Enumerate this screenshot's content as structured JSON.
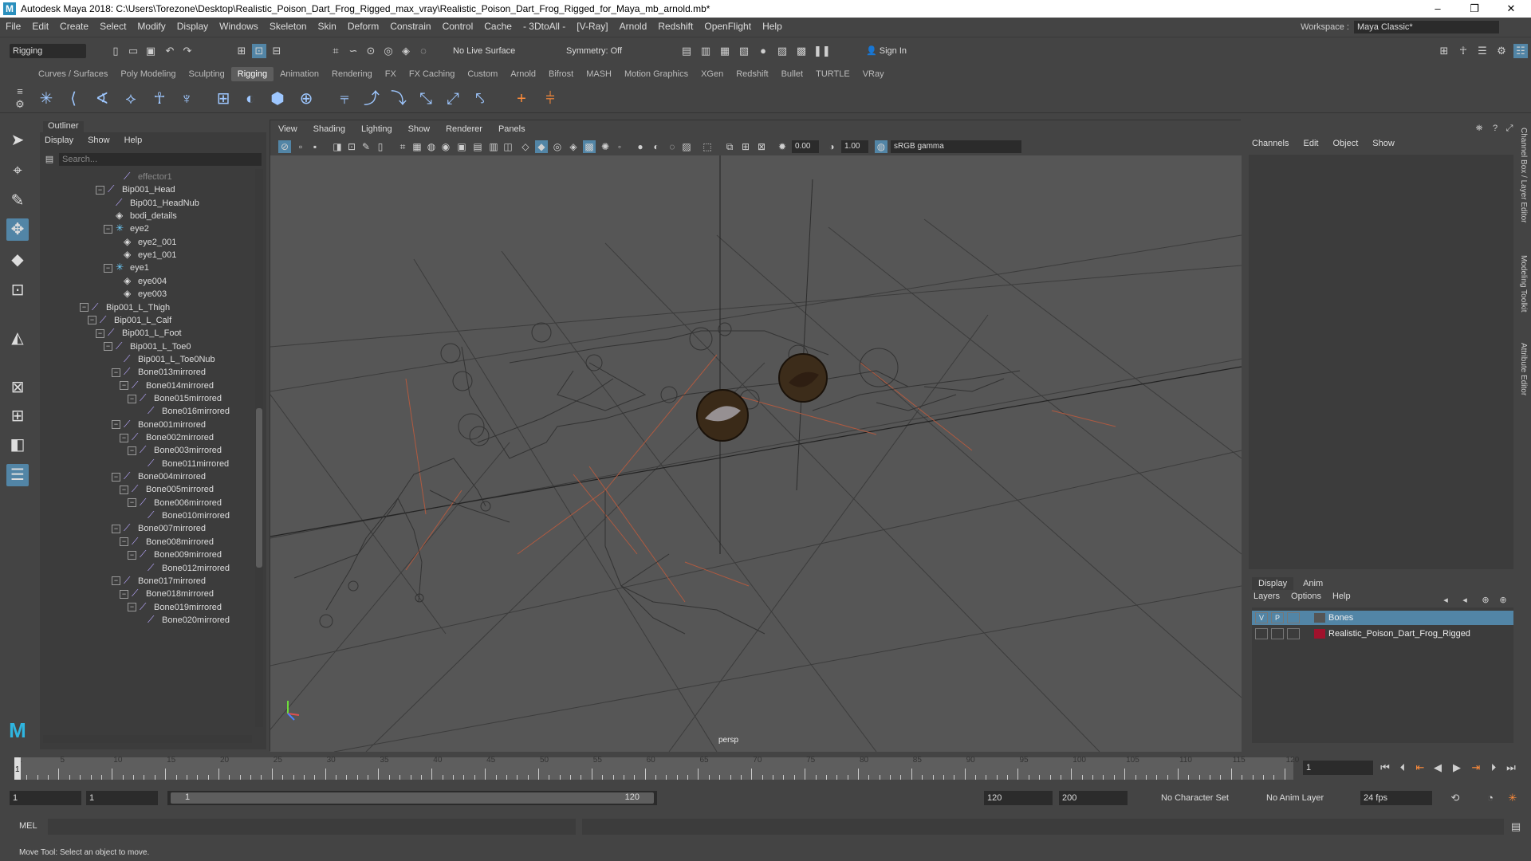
{
  "title": "Autodesk Maya 2018: C:\\Users\\Torezone\\Desktop\\Realistic_Poison_Dart_Frog_Rigged_max_vray\\Realistic_Poison_Dart_Frog_Rigged_for_Maya_mb_arnold.mb*",
  "window_controls": {
    "minimize": "–",
    "restore": "❐",
    "close": "✕"
  },
  "menu": [
    "File",
    "Edit",
    "Create",
    "Select",
    "Modify",
    "Display",
    "Windows",
    "Skeleton",
    "Skin",
    "Deform",
    "Constrain",
    "Control",
    "Cache",
    "- 3DtoAll -",
    "[V-Ray]",
    "Arnold",
    "Redshift",
    "OpenFlight",
    "Help"
  ],
  "workspace": {
    "label": "Workspace :",
    "value": "Maya Classic*"
  },
  "status": {
    "menu_set": "Rigging",
    "live_surface": "No Live Surface",
    "symmetry": "Symmetry: Off",
    "sign_in": "Sign In"
  },
  "shelf_tabs": [
    "Curves / Surfaces",
    "Poly Modeling",
    "Sculpting",
    "Rigging",
    "Animation",
    "Rendering",
    "FX",
    "FX Caching",
    "Custom",
    "Arnold",
    "Bifrost",
    "MASH",
    "Motion Graphics",
    "XGen",
    "Redshift",
    "Bullet",
    "TURTLE",
    "VRay"
  ],
  "shelf_active": "Rigging",
  "outliner": {
    "title": "Outliner",
    "menu": [
      "Display",
      "Show",
      "Help"
    ],
    "search_placeholder": "Search...",
    "nodes": [
      {
        "label": "effector1",
        "depth": 5,
        "type": "joint",
        "exp": ""
      },
      {
        "label": "Bip001_Head",
        "depth": 3,
        "type": "joint",
        "exp": "−"
      },
      {
        "label": "Bip001_HeadNub",
        "depth": 4,
        "type": "joint",
        "exp": ""
      },
      {
        "label": "bodi_details",
        "depth": 4,
        "type": "mesh",
        "exp": ""
      },
      {
        "label": "eye2",
        "depth": 4,
        "type": "grp",
        "exp": "−"
      },
      {
        "label": "eye2_001",
        "depth": 5,
        "type": "mesh",
        "exp": ""
      },
      {
        "label": "eye1_001",
        "depth": 5,
        "type": "mesh",
        "exp": ""
      },
      {
        "label": "eye1",
        "depth": 4,
        "type": "grp",
        "exp": "−"
      },
      {
        "label": "eye004",
        "depth": 5,
        "type": "mesh",
        "exp": ""
      },
      {
        "label": "eye003",
        "depth": 5,
        "type": "mesh",
        "exp": ""
      },
      {
        "label": "Bip001_L_Thigh",
        "depth": 1,
        "type": "joint",
        "exp": "−"
      },
      {
        "label": "Bip001_L_Calf",
        "depth": 2,
        "type": "joint",
        "exp": "−"
      },
      {
        "label": "Bip001_L_Foot",
        "depth": 3,
        "type": "joint",
        "exp": "−"
      },
      {
        "label": "Bip001_L_Toe0",
        "depth": 4,
        "type": "joint",
        "exp": "−"
      },
      {
        "label": "Bip001_L_Toe0Nub",
        "depth": 5,
        "type": "joint",
        "exp": ""
      },
      {
        "label": "Bone013mirrored",
        "depth": 5,
        "type": "joint",
        "exp": "−"
      },
      {
        "label": "Bone014mirrored",
        "depth": 6,
        "type": "joint",
        "exp": "−"
      },
      {
        "label": "Bone015mirrored",
        "depth": 7,
        "type": "joint",
        "exp": "−"
      },
      {
        "label": "Bone016mirrored",
        "depth": 8,
        "type": "joint",
        "exp": ""
      },
      {
        "label": "Bone001mirrored",
        "depth": 5,
        "type": "joint",
        "exp": "−"
      },
      {
        "label": "Bone002mirrored",
        "depth": 6,
        "type": "joint",
        "exp": "−"
      },
      {
        "label": "Bone003mirrored",
        "depth": 7,
        "type": "joint",
        "exp": "−"
      },
      {
        "label": "Bone011mirrored",
        "depth": 8,
        "type": "joint",
        "exp": ""
      },
      {
        "label": "Bone004mirrored",
        "depth": 5,
        "type": "joint",
        "exp": "−"
      },
      {
        "label": "Bone005mirrored",
        "depth": 6,
        "type": "joint",
        "exp": "−"
      },
      {
        "label": "Bone006mirrored",
        "depth": 7,
        "type": "joint",
        "exp": "−"
      },
      {
        "label": "Bone010mirrored",
        "depth": 8,
        "type": "joint",
        "exp": ""
      },
      {
        "label": "Bone007mirrored",
        "depth": 5,
        "type": "joint",
        "exp": "−"
      },
      {
        "label": "Bone008mirrored",
        "depth": 6,
        "type": "joint",
        "exp": "−"
      },
      {
        "label": "Bone009mirrored",
        "depth": 7,
        "type": "joint",
        "exp": "−"
      },
      {
        "label": "Bone012mirrored",
        "depth": 8,
        "type": "joint",
        "exp": ""
      },
      {
        "label": "Bone017mirrored",
        "depth": 5,
        "type": "joint",
        "exp": "−"
      },
      {
        "label": "Bone018mirrored",
        "depth": 6,
        "type": "joint",
        "exp": "−"
      },
      {
        "label": "Bone019mirrored",
        "depth": 7,
        "type": "joint",
        "exp": "−"
      },
      {
        "label": "Bone020mirrored",
        "depth": 8,
        "type": "joint",
        "exp": ""
      }
    ]
  },
  "viewport": {
    "menu": [
      "View",
      "Shading",
      "Lighting",
      "Show",
      "Renderer",
      "Panels"
    ],
    "exposure": "0.00",
    "gamma": "1.00",
    "colorspace": "sRGB gamma",
    "camera": "persp"
  },
  "channel_box": {
    "menu": [
      "Channels",
      "Edit",
      "Object",
      "Show"
    ]
  },
  "layer_editor": {
    "tabs": [
      "Display",
      "Anim"
    ],
    "menu": [
      "Layers",
      "Options",
      "Help"
    ],
    "layers": [
      {
        "v": "V",
        "p": "P",
        "name": "Bones",
        "color": "#555555",
        "selected": true
      },
      {
        "v": "",
        "p": "",
        "name": "Realistic_Poison_Dart_Frog_Rigged",
        "color": "#a0122c",
        "selected": false
      }
    ]
  },
  "side_tabs": [
    "Channel Box / Layer Editor",
    "Modeling Toolkit",
    "Attribute Editor"
  ],
  "timeline": {
    "labels": [
      "1",
      "5",
      "10",
      "15",
      "20",
      "25",
      "30",
      "35",
      "40",
      "45",
      "50",
      "55",
      "60",
      "65",
      "70",
      "75",
      "80",
      "85",
      "90",
      "95",
      "100",
      "105",
      "110",
      "115",
      "120"
    ],
    "current_frame": "1"
  },
  "range": {
    "start": "1",
    "playback_start": "1",
    "slider_start": "1",
    "slider_end": "120",
    "playback_end": "120",
    "end": "200",
    "character_set": "No Character Set",
    "anim_layer": "No Anim Layer",
    "fps": "24 fps"
  },
  "cmd": {
    "label": "MEL"
  },
  "help_line": "Move Tool: Select an object to move."
}
